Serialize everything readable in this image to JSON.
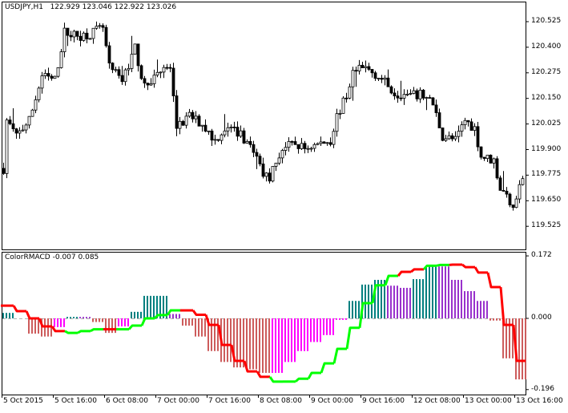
{
  "main": {
    "symbol": "USDJPY,H1",
    "ohlc": [
      "122.929",
      "123.046",
      "122.922",
      "123.026"
    ],
    "price_axis": [
      "120.525",
      "120.400",
      "120.275",
      "120.150",
      "120.025",
      "119.900",
      "119.775",
      "119.650",
      "119.525"
    ],
    "price_axis_values": [
      120.525,
      120.4,
      120.275,
      120.15,
      120.025,
      119.9,
      119.775,
      119.65,
      119.525
    ],
    "bar_count": 164,
    "price_path": [
      [
        1,
        120.043
      ],
      [
        4,
        119.965
      ],
      [
        8,
        120.043
      ],
      [
        12,
        120.259
      ],
      [
        16,
        120.239
      ],
      [
        19,
        120.474
      ],
      [
        23,
        120.454
      ],
      [
        27,
        120.466
      ],
      [
        31,
        120.494
      ],
      [
        33,
        120.298
      ],
      [
        37,
        120.239
      ],
      [
        41,
        120.396
      ],
      [
        44,
        120.2
      ],
      [
        48,
        120.278
      ],
      [
        52,
        120.298
      ],
      [
        54,
        120.004
      ],
      [
        58,
        120.063
      ],
      [
        62,
        120.024
      ],
      [
        66,
        119.945
      ],
      [
        69,
        120.004
      ],
      [
        73,
        119.984
      ],
      [
        77,
        119.926
      ],
      [
        81,
        119.788
      ],
      [
        83,
        119.769
      ],
      [
        87,
        119.906
      ],
      [
        91,
        119.926
      ],
      [
        94,
        119.906
      ],
      [
        98,
        119.926
      ],
      [
        102,
        119.945
      ],
      [
        104,
        120.063
      ],
      [
        107,
        120.161
      ],
      [
        109,
        120.278
      ],
      [
        113,
        120.298
      ],
      [
        117,
        120.259
      ],
      [
        122,
        120.18
      ],
      [
        127,
        120.161
      ],
      [
        131,
        120.168
      ],
      [
        134,
        120.121
      ],
      [
        137,
        119.965
      ],
      [
        141,
        119.945
      ],
      [
        144,
        120.043
      ],
      [
        147,
        120.004
      ],
      [
        149,
        119.867
      ],
      [
        153,
        119.847
      ],
      [
        155,
        119.71
      ],
      [
        159,
        119.632
      ],
      [
        163,
        119.808
      ]
    ]
  },
  "indicator": {
    "name": "ColorRMACD",
    "values": [
      "-0.007",
      "0.085"
    ],
    "axis": [
      "0.172",
      "0.000",
      "-0.196"
    ],
    "axis_values": [
      0.172,
      0.0,
      -0.196
    ],
    "colors": {
      "T": "#008080",
      "B": "#cd5c5c",
      "M": "#ff00ff",
      "P": "#9932cc",
      "R": "#ff0000",
      "G": "#00ff00"
    },
    "bars_per_group": 4,
    "histogram": [
      [
        0.015,
        "T"
      ],
      [
        0,
        "T"
      ],
      [
        -0.042,
        "B"
      ],
      [
        -0.05,
        "B"
      ],
      [
        -0.024,
        "M"
      ],
      [
        0.004,
        "T"
      ],
      [
        0.004,
        "P"
      ],
      [
        -0.01,
        "B"
      ],
      [
        -0.04,
        "B"
      ],
      [
        -0.022,
        "M"
      ],
      [
        0.018,
        "T"
      ],
      [
        0.062,
        "T"
      ],
      [
        0.062,
        "T"
      ],
      [
        0.012,
        "P"
      ],
      [
        -0.02,
        "B"
      ],
      [
        -0.05,
        "B"
      ],
      [
        -0.09,
        "B"
      ],
      [
        -0.12,
        "B"
      ],
      [
        -0.135,
        "B"
      ],
      [
        -0.14,
        "B"
      ],
      [
        -0.15,
        "B"
      ],
      [
        -0.15,
        "M"
      ],
      [
        -0.12,
        "M"
      ],
      [
        -0.09,
        "M"
      ],
      [
        -0.065,
        "M"
      ],
      [
        -0.046,
        "M"
      ],
      [
        -0.004,
        "M"
      ],
      [
        0.048,
        "T"
      ],
      [
        0.093,
        "T"
      ],
      [
        0.106,
        "T"
      ],
      [
        0.09,
        "P"
      ],
      [
        0.084,
        "P"
      ],
      [
        0.108,
        "T"
      ],
      [
        0.143,
        "T"
      ],
      [
        0.143,
        "P"
      ],
      [
        0.106,
        "P"
      ],
      [
        0.075,
        "P"
      ],
      [
        0.048,
        "P"
      ],
      [
        -0.006,
        "B"
      ],
      [
        -0.11,
        "B"
      ],
      [
        -0.168,
        "B"
      ]
    ],
    "signal": [
      [
        0.035,
        "R"
      ],
      [
        0.02,
        "R"
      ],
      [
        0.0,
        "R"
      ],
      [
        -0.022,
        "R"
      ],
      [
        -0.035,
        "R"
      ],
      [
        -0.04,
        "G"
      ],
      [
        -0.035,
        "G"
      ],
      [
        -0.03,
        "G"
      ],
      [
        -0.03,
        "R"
      ],
      [
        -0.03,
        "G"
      ],
      [
        -0.02,
        "G"
      ],
      [
        0.0,
        "G"
      ],
      [
        0.009,
        "G"
      ],
      [
        0.022,
        "G"
      ],
      [
        0.022,
        "R"
      ],
      [
        0.01,
        "R"
      ],
      [
        -0.018,
        "R"
      ],
      [
        -0.073,
        "R"
      ],
      [
        -0.117,
        "R"
      ],
      [
        -0.146,
        "R"
      ],
      [
        -0.161,
        "R"
      ],
      [
        -0.174,
        "G"
      ],
      [
        -0.174,
        "G"
      ],
      [
        -0.166,
        "G"
      ],
      [
        -0.15,
        "G"
      ],
      [
        -0.124,
        "G"
      ],
      [
        -0.084,
        "G"
      ],
      [
        -0.026,
        "G"
      ],
      [
        0.042,
        "G"
      ],
      [
        0.091,
        "G"
      ],
      [
        0.117,
        "G"
      ],
      [
        0.128,
        "R"
      ],
      [
        0.135,
        "R"
      ],
      [
        0.145,
        "G"
      ],
      [
        0.147,
        "G"
      ],
      [
        0.148,
        "R"
      ],
      [
        0.141,
        "R"
      ],
      [
        0.126,
        "R"
      ],
      [
        0.086,
        "R"
      ],
      [
        -0.018,
        "R"
      ],
      [
        -0.117,
        "R"
      ]
    ]
  },
  "time_axis": [
    "5 Oct 2015",
    "5 Oct 16:00",
    "6 Oct 08:00",
    "7 Oct 00:00",
    "7 Oct 16:00",
    "8 Oct 08:00",
    "9 Oct 00:00",
    "9 Oct 16:00",
    "12 Oct 08:00",
    "13 Oct 00:00",
    "13 Oct 16:00"
  ]
}
